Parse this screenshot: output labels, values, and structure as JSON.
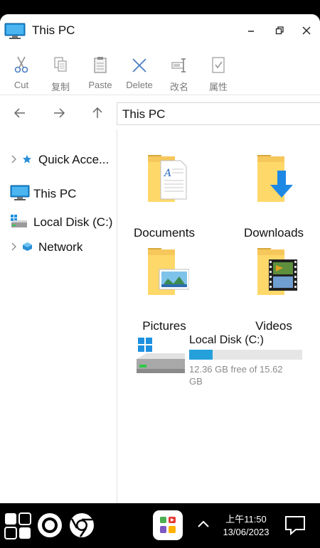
{
  "window": {
    "title": "This PC"
  },
  "ribbon": {
    "cut": "Cut",
    "copy": "复制",
    "paste": "Paste",
    "delete": "Delete",
    "rename": "改名",
    "properties": "属性"
  },
  "address": {
    "path": "This PC"
  },
  "sidebar": {
    "items": [
      {
        "label": "Quick Acce..."
      },
      {
        "label": "This PC"
      },
      {
        "label": "Local Disk (C:)"
      },
      {
        "label": "Network"
      }
    ]
  },
  "content": {
    "folders": [
      {
        "label": "Documents"
      },
      {
        "label": "Downloads"
      },
      {
        "label": "Pictures"
      },
      {
        "label": "Videos"
      }
    ],
    "drive": {
      "name": "Local Disk (C:)",
      "free_text": "12.36 GB free of 15.62 GB",
      "used_fraction": 0.21
    }
  },
  "taskbar": {
    "time": "上午11:50",
    "date": "13/06/2023"
  }
}
